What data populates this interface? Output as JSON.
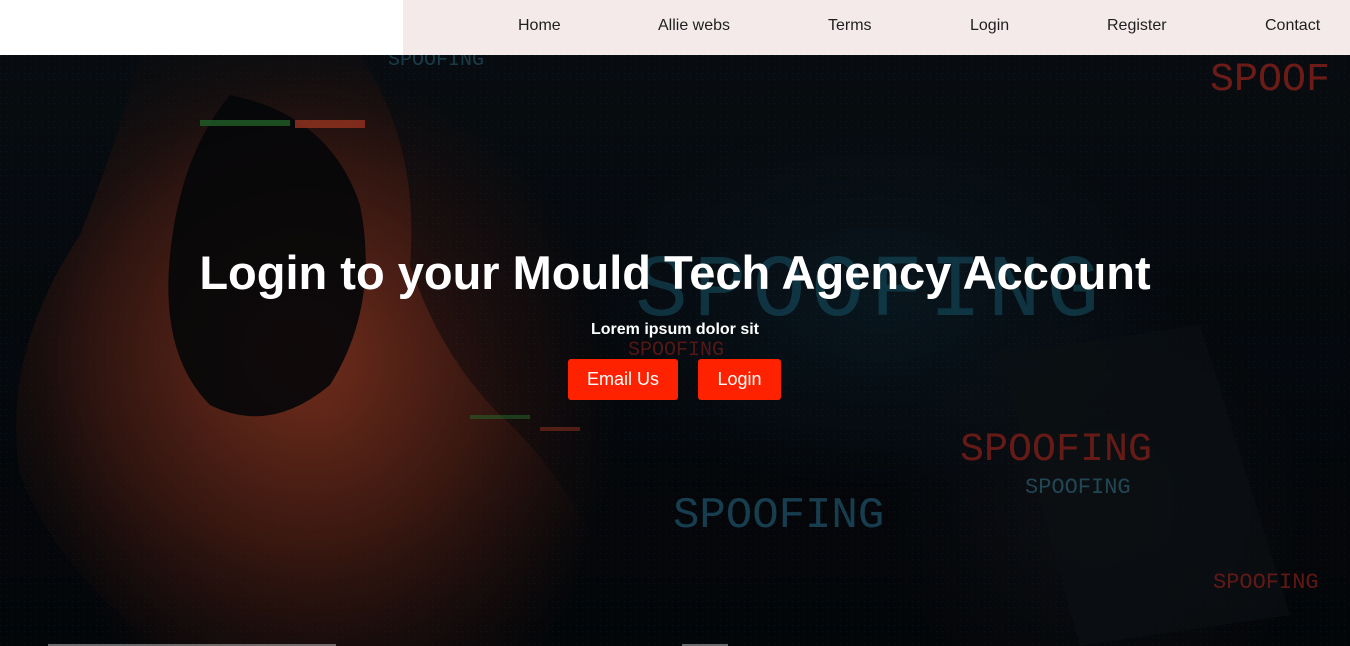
{
  "nav": {
    "items": [
      {
        "label": "Home"
      },
      {
        "label": "Allie webs"
      },
      {
        "label": "Terms"
      },
      {
        "label": "Login"
      },
      {
        "label": "Register"
      },
      {
        "label": "Contact"
      }
    ]
  },
  "hero": {
    "title": "Login to your Mould Tech Agency Account",
    "subtitle": "Lorem ipsum dolor sit",
    "buttons": {
      "email_label": "Email Us",
      "login_label": "Login"
    },
    "background_text": [
      "SPOOFING",
      "SPOOF",
      "SPOOFING",
      "SPOOFING",
      "SPOOFING",
      "SPOOFING",
      "SPOOFING",
      "SPOOFING"
    ]
  },
  "colors": {
    "nav_background": "#f4eaea",
    "button_background": "#ff2200",
    "hero_background": "#070b10",
    "title_color": "#ffffff"
  }
}
